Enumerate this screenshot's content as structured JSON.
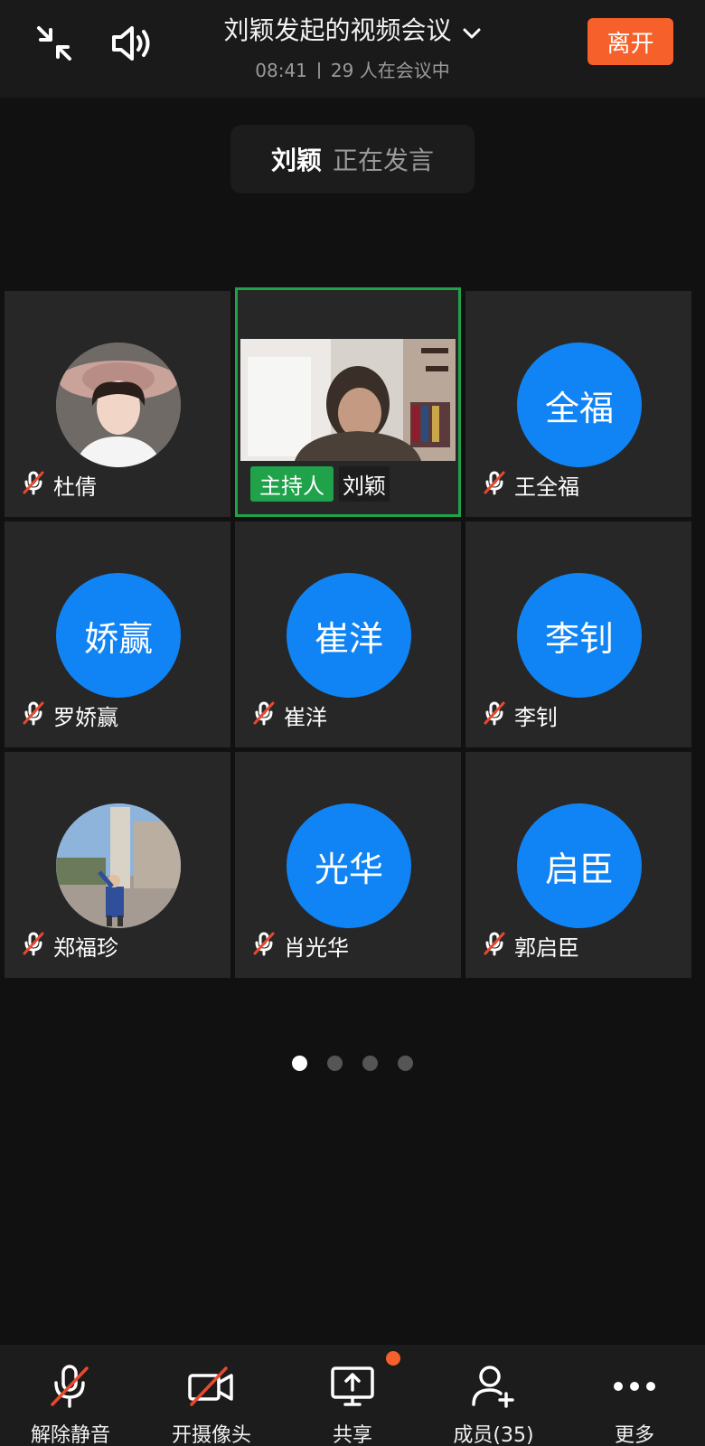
{
  "header": {
    "title": "刘颖发起的视频会议",
    "time": "08:41",
    "participants_text": "29 人在会议中",
    "leave_label": "离开"
  },
  "speaker": {
    "name": "刘颖",
    "status": "正在发言"
  },
  "tiles": [
    {
      "name": "杜倩",
      "avatar_text": "",
      "avatar_kind": "photo-woman-hat"
    },
    {
      "name": "刘颖",
      "host_badge": "主持人",
      "avatar_kind": "video"
    },
    {
      "name": "王全福",
      "avatar_text": "全福"
    },
    {
      "name": "罗娇赢",
      "avatar_text": "娇赢"
    },
    {
      "name": "崔洋",
      "avatar_text": "崔洋"
    },
    {
      "name": "李钊",
      "avatar_text": "李钊"
    },
    {
      "name": "郑福珍",
      "avatar_text": "",
      "avatar_kind": "photo-outdoor"
    },
    {
      "name": "肖光华",
      "avatar_text": "光华"
    },
    {
      "name": "郭启臣",
      "avatar_text": "启臣"
    }
  ],
  "pagination": {
    "pages": 4,
    "current": 1
  },
  "toolbar": {
    "unmute_label": "解除静音",
    "camera_label": "开摄像头",
    "share_label": "共享",
    "members_label": "成员(35)",
    "more_label": "更多"
  },
  "colors": {
    "accent_orange": "#f5602b",
    "avatar_blue": "#1184f5",
    "host_green": "#1fa24a",
    "mute_red": "#e8492f"
  }
}
